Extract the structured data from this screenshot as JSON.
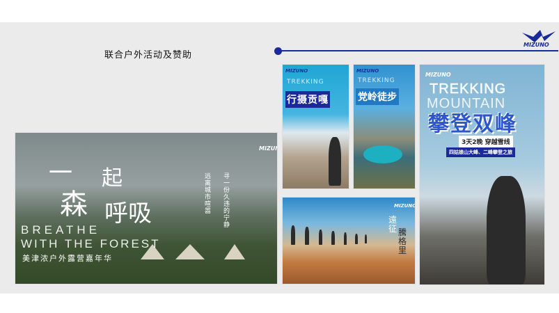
{
  "slide": {
    "title": "联合户外活动及赞助",
    "brand": "MIZUNO",
    "colors": {
      "accent": "#1b2a9a",
      "slide_bg": "#ebebeb"
    }
  },
  "posters": {
    "forest": {
      "logo": "MIZUNO",
      "heading_1": "一",
      "heading_2": "起",
      "heading_3": "森",
      "heading_4": "呼吸",
      "english_1": "BREATHE",
      "english_2": "WITH THE FOREST",
      "footer": "美津浓户外露营嘉年华",
      "vertical_1": "远离城市喧嚣",
      "vertical_2": "寻一份久违的宁静"
    },
    "gongga": {
      "logo": "MIZUNO",
      "title": "行摄贡嘎",
      "subtitle": "TREKKING"
    },
    "dangling": {
      "logo": "MIZUNO",
      "title": "党岭徒步",
      "subtitle": "TREKKING"
    },
    "shuangfeng": {
      "logo": "MIZUNO",
      "english_1": "TREKKING",
      "english_2": "MOUNTAIN",
      "title": "攀登双峰",
      "tag": "3天2晚 穿越雪线",
      "tag2": "四姑娘山大峰、二峰攀登之旅"
    },
    "desert": {
      "logo": "MIZUNO",
      "vertical_1": "遠征",
      "vertical_2": "騰格里"
    }
  }
}
